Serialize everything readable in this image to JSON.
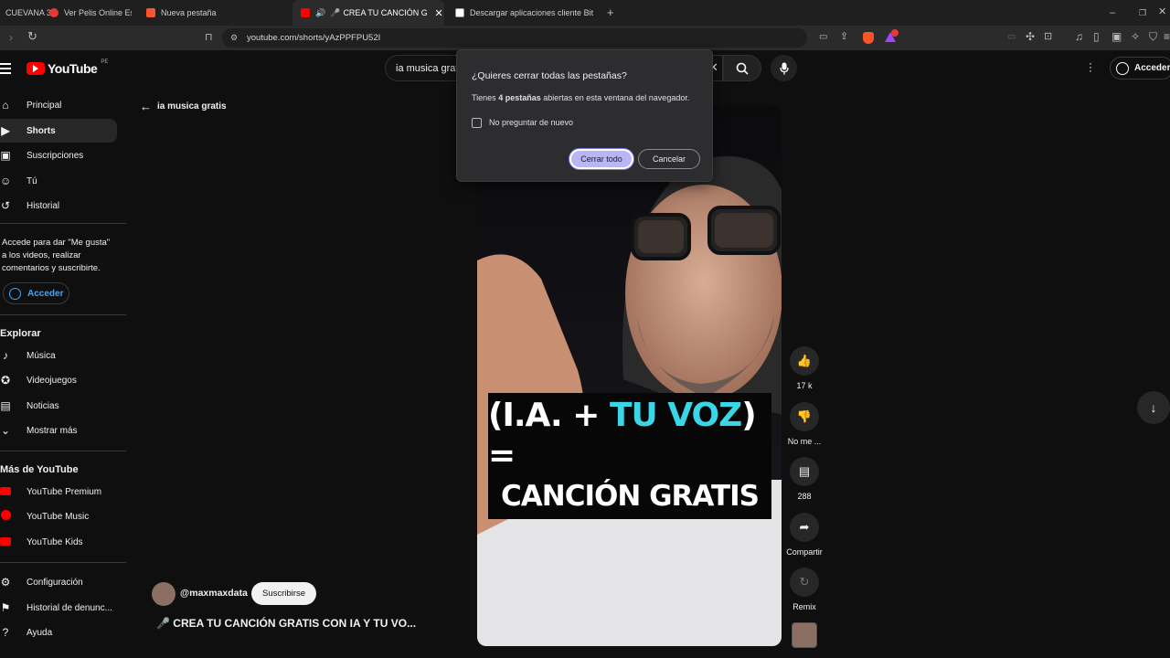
{
  "browser": {
    "tabs": [
      {
        "label": "CUEVANA 3",
        "color": "#444444"
      },
      {
        "label": "Ver Pelis Online Estr",
        "color": "#e53935"
      },
      {
        "label": "Nueva pestaña",
        "color": "#fb542b"
      },
      {
        "label": "CREA TU CANCIÓN GRAT",
        "color": "#ff0000"
      },
      {
        "label": "Descargar aplicaciones cliente BitTorr",
        "color": "#dddddd"
      }
    ],
    "url": "youtube.com/shorts/yAzPPFPU52I"
  },
  "youtube": {
    "logo_text": "YouTube",
    "region": "PE",
    "search_value": "ia musica grat",
    "signin_label": "Acceder",
    "back_label": "ia musica gratis",
    "sidebar": {
      "main": [
        {
          "label": "Principal",
          "icon": "home-icon"
        },
        {
          "label": "Shorts",
          "icon": "shorts-icon"
        },
        {
          "label": "Suscripciones",
          "icon": "subscriptions-icon"
        },
        {
          "label": "Tú",
          "icon": "you-icon"
        },
        {
          "label": "Historial",
          "icon": "history-icon"
        }
      ],
      "signin_prompt": "Accede para dar \"Me gusta\" a los videos, realizar comentarios y suscribirte.",
      "signin_button": "Acceder",
      "explore_title": "Explorar",
      "explore": [
        {
          "label": "Música",
          "icon": "music-icon"
        },
        {
          "label": "Videojuegos",
          "icon": "gaming-icon"
        },
        {
          "label": "Noticias",
          "icon": "news-icon"
        },
        {
          "label": "Mostrar más",
          "icon": "chevron-down-icon"
        }
      ],
      "more_title": "Más de YouTube",
      "more": [
        {
          "label": "YouTube Premium"
        },
        {
          "label": "YouTube Music"
        },
        {
          "label": "YouTube Kids"
        }
      ],
      "settings": [
        {
          "label": "Configuración",
          "icon": "gear-icon"
        },
        {
          "label": "Historial de denunc...",
          "icon": "flag-icon"
        },
        {
          "label": "Ayuda",
          "icon": "help-icon"
        }
      ]
    },
    "short": {
      "overlay_line1_a": "(I.A. + ",
      "overlay_line1_b": "TU VOZ",
      "overlay_line1_c": ") =",
      "overlay_line2": "CANCIÓN GRATIS",
      "channel": "@maxmaxdata",
      "subscribe": "Suscribirse",
      "title": "🎤 CREA TU CANCIÓN GRATIS CON IA Y TU VO..."
    },
    "actions": {
      "likes": "17 k",
      "dislike": "No me ...",
      "comments": "288",
      "share": "Compartir",
      "remix": "Remix"
    }
  },
  "dialog": {
    "title": "¿Quieres cerrar todas las pestañas?",
    "body_pre": "Tienes ",
    "body_bold": "4 pestañas",
    "body_post": " abiertas en esta ventana del navegador.",
    "checkbox_label": "No preguntar de nuevo",
    "confirm": "Cerrar todo",
    "cancel": "Cancelar"
  }
}
